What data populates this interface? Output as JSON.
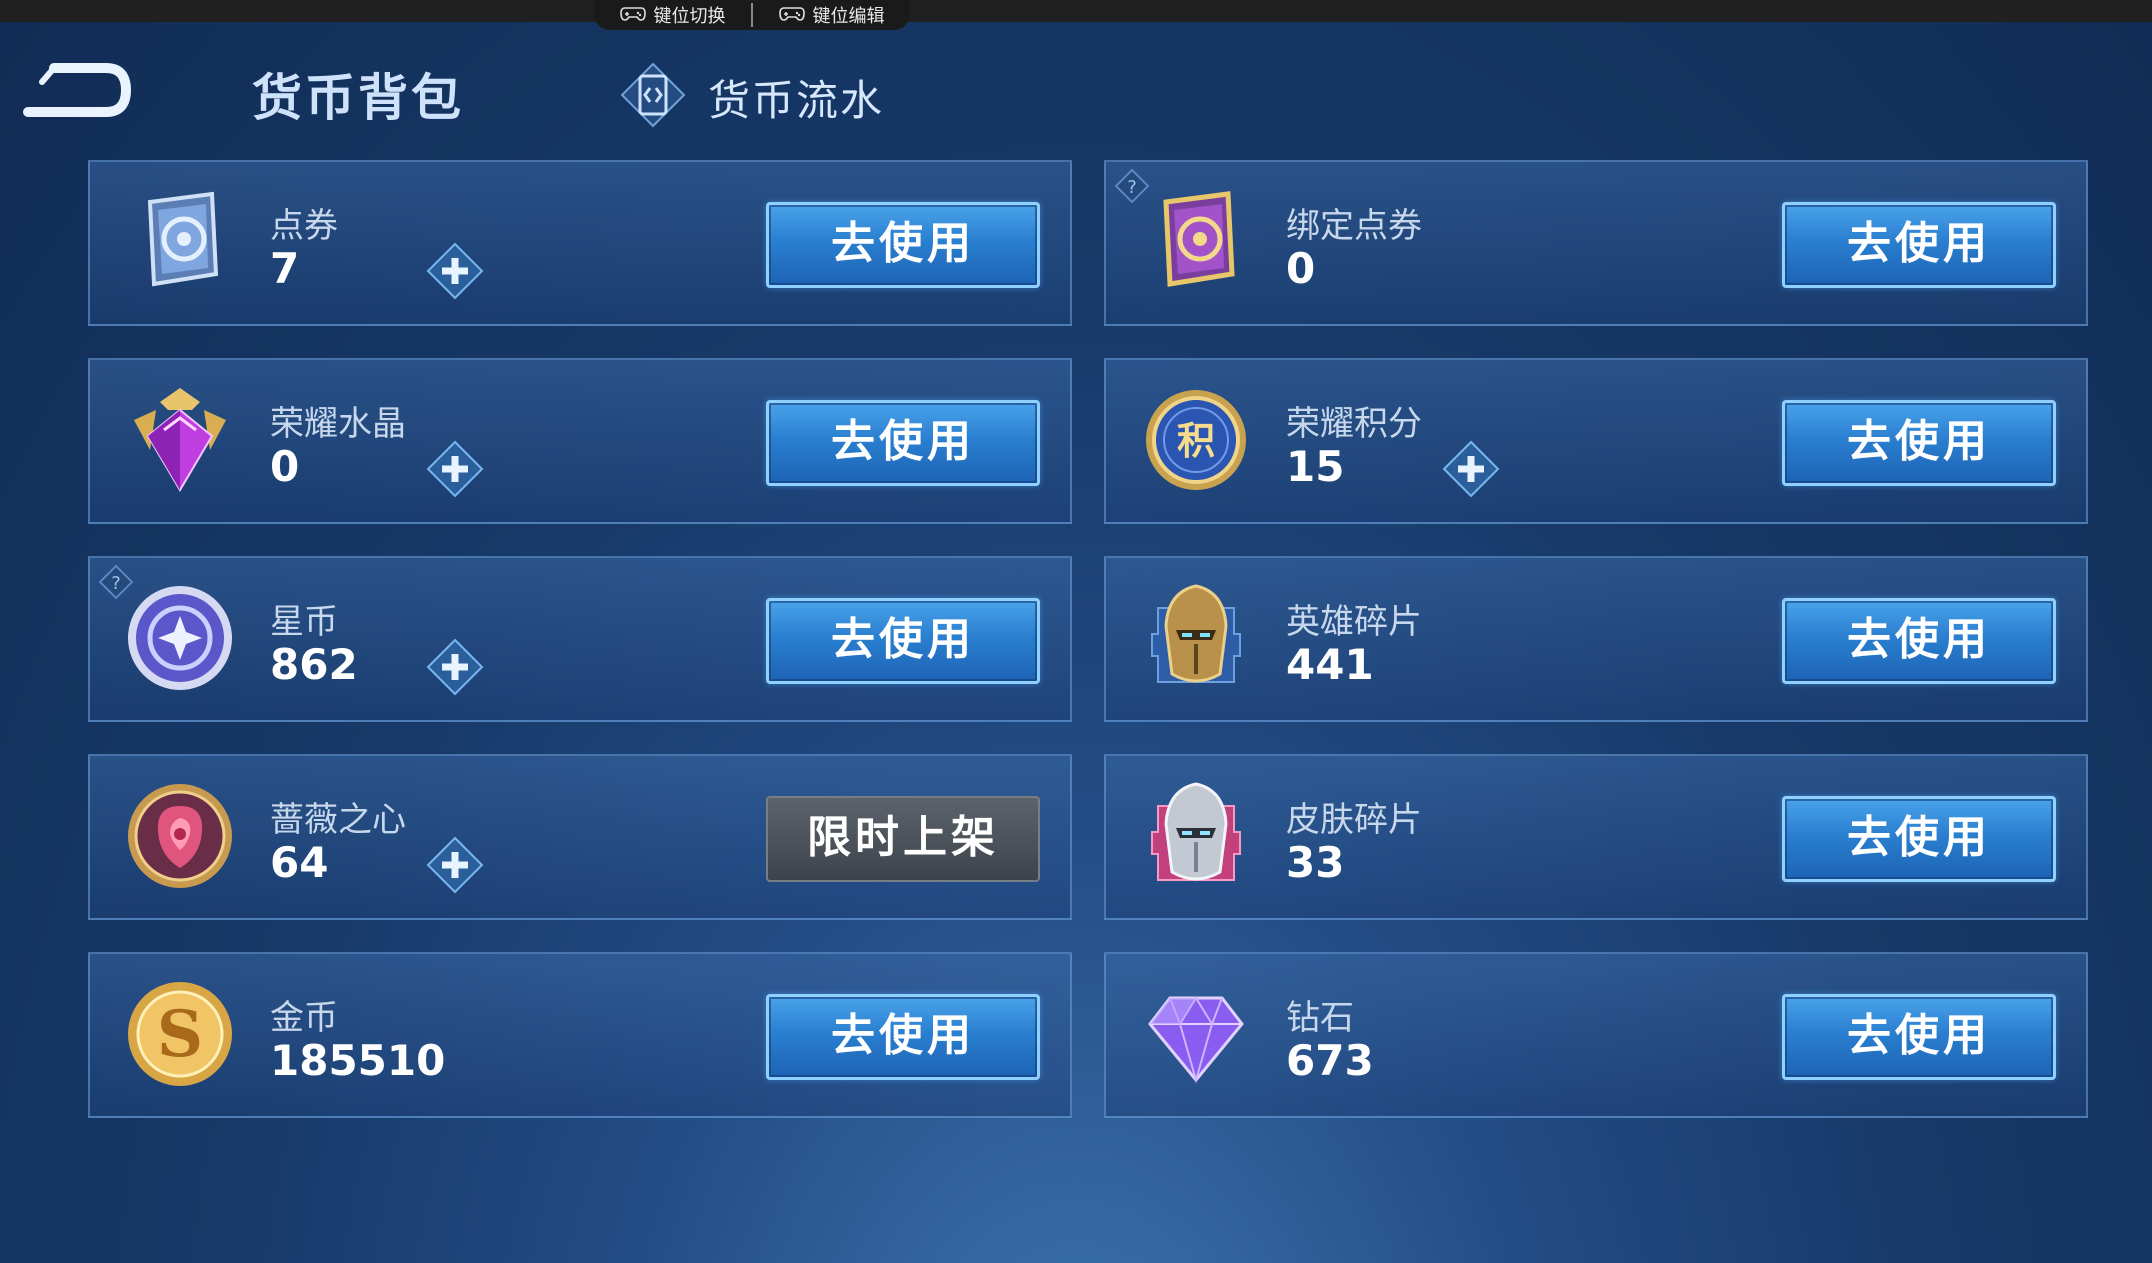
{
  "top_bar": {
    "key_switch_label": "键位切换",
    "key_edit_label": "键位编辑"
  },
  "header": {
    "title": "货币背包",
    "flow_tab_label": "货币流水"
  },
  "currencies": [
    {
      "name": "点券",
      "value": "7",
      "icon": "coupon-icon",
      "action": "去使用"
    },
    {
      "name": "绑定点券",
      "value": "0",
      "icon": "bound-coupon-icon",
      "action": "去使用"
    },
    {
      "name": "荣耀水晶",
      "value": "0",
      "icon": "glory-crystal-icon",
      "action": "去使用"
    },
    {
      "name": "荣耀积分",
      "value": "15",
      "icon": "glory-points-icon",
      "action": "去使用"
    },
    {
      "name": "星币",
      "value": "862",
      "icon": "star-coin-icon",
      "action": "去使用"
    },
    {
      "name": "英雄碎片",
      "value": "441",
      "icon": "hero-fragment-icon",
      "action": "去使用"
    },
    {
      "name": "蔷薇之心",
      "value": "64",
      "icon": "rose-heart-icon",
      "action": "限时上架"
    },
    {
      "name": "皮肤碎片",
      "value": "33",
      "icon": "skin-fragment-icon",
      "action": "去使用"
    },
    {
      "name": "金币",
      "value": "185510",
      "icon": "gold-coin-icon",
      "action": "去使用"
    },
    {
      "name": "钻石",
      "value": "673",
      "icon": "diamond-icon",
      "action": "去使用"
    }
  ],
  "colors": {
    "button_blue": "#2a7fd0",
    "button_disabled": "#4a5058",
    "plus_icon": "#7ec4ff",
    "background": "#173a6a"
  }
}
